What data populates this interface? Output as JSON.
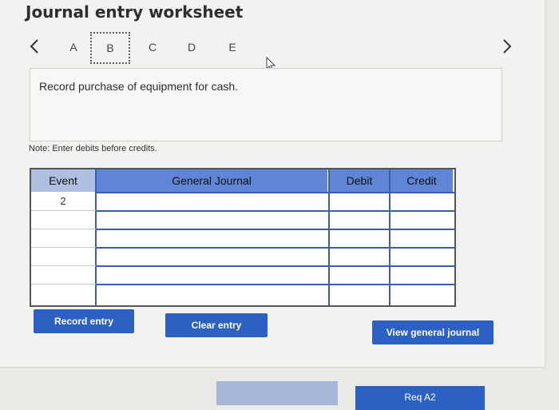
{
  "title": "Journal entry worksheet",
  "tabs": [
    {
      "label": "A",
      "active": false
    },
    {
      "label": "B",
      "active": true
    },
    {
      "label": "C",
      "active": false
    },
    {
      "label": "D",
      "active": false
    },
    {
      "label": "E",
      "active": false
    }
  ],
  "description": "Record purchase of equipment for cash.",
  "note": "Note: Enter debits before credits.",
  "table": {
    "headers": {
      "event": "Event",
      "general_journal": "General Journal",
      "debit": "Debit",
      "credit": "Credit"
    },
    "rows": [
      {
        "event": "2",
        "account": "",
        "debit": "",
        "credit": ""
      },
      {
        "event": "",
        "account": "",
        "debit": "",
        "credit": ""
      },
      {
        "event": "",
        "account": "",
        "debit": "",
        "credit": ""
      },
      {
        "event": "",
        "account": "",
        "debit": "",
        "credit": ""
      },
      {
        "event": "",
        "account": "",
        "debit": "",
        "credit": ""
      },
      {
        "event": "",
        "account": "",
        "debit": "",
        "credit": ""
      }
    ]
  },
  "buttons": {
    "record": "Record entry",
    "clear": "Clear entry",
    "view_journal": "View general journal"
  },
  "footer": {
    "prev_label": "",
    "next_label": "Req A2"
  },
  "colors": {
    "accent": "#2c61c3",
    "header": "#5f86d6",
    "grid": "#3b5fb0"
  },
  "icons": [
    "chevron-left-icon",
    "chevron-right-icon",
    "cursor-hand-icon"
  ]
}
